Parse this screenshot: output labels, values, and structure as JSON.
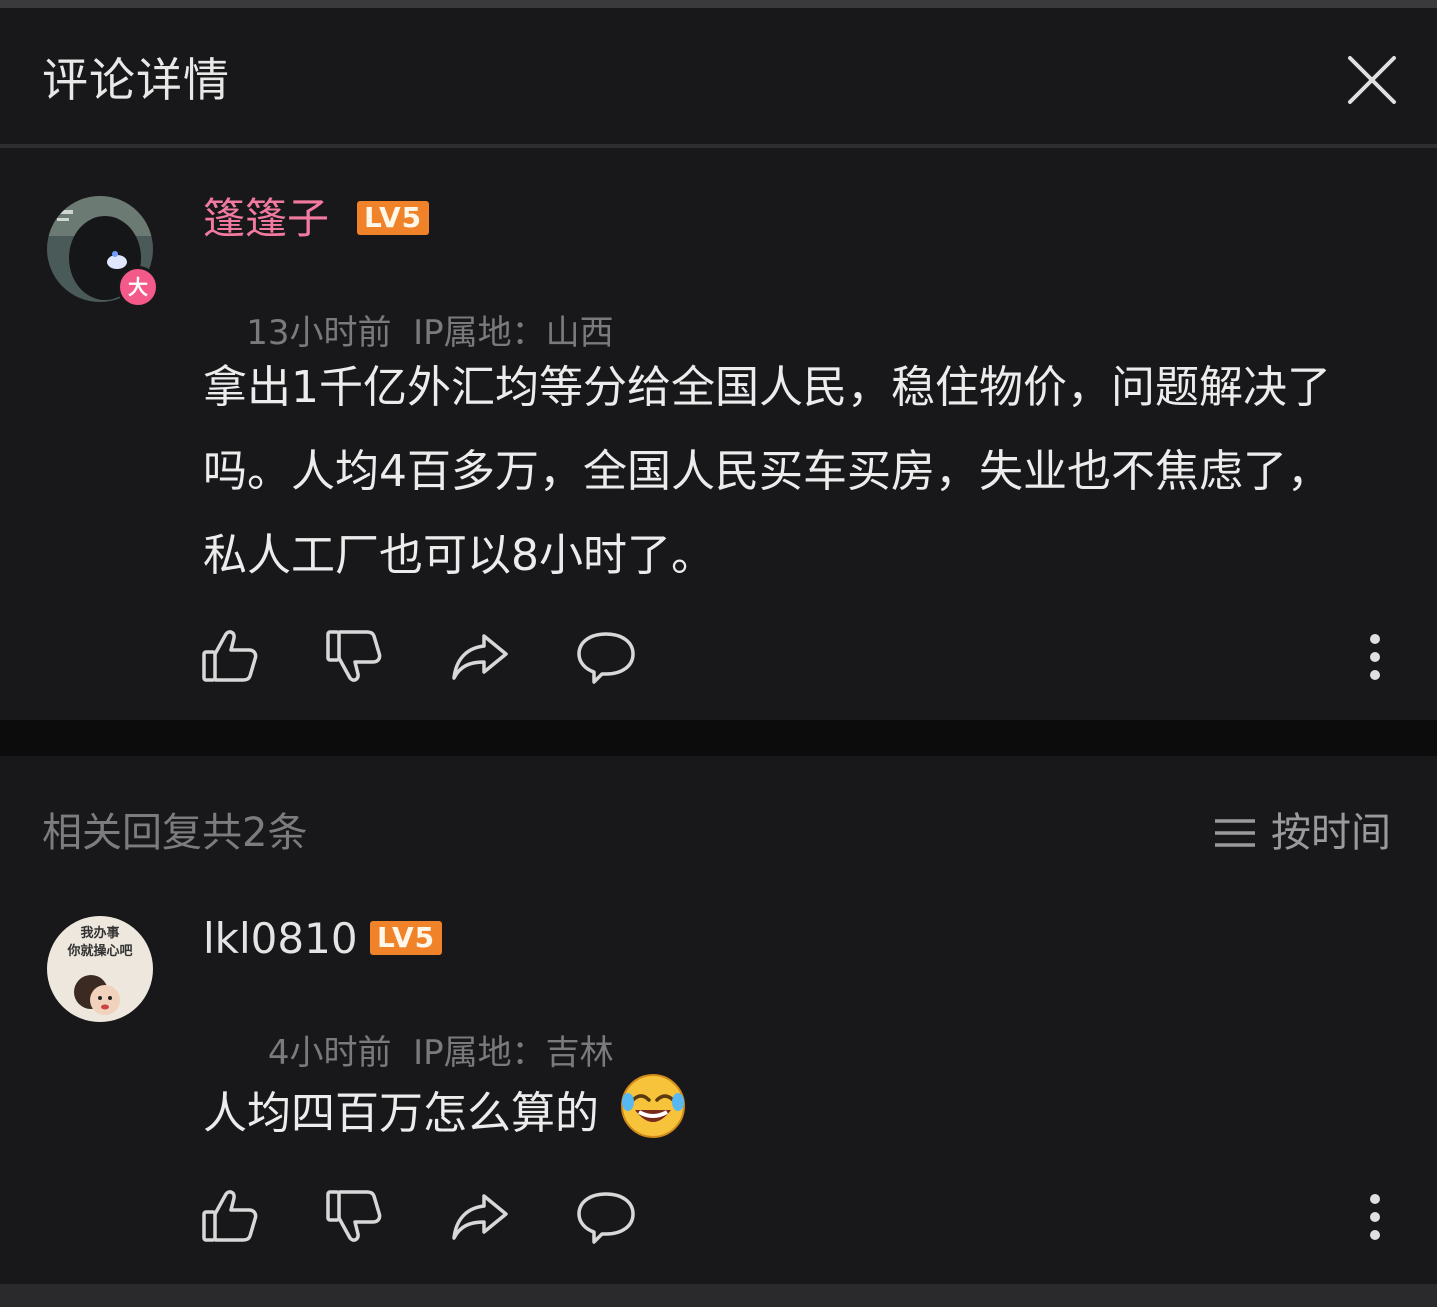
{
  "header": {
    "title": "评论详情"
  },
  "main_comment": {
    "username": "篷篷子",
    "level": "LV5",
    "avatar_badge": "大",
    "time": "13小时前",
    "ip": "IP属地：山西",
    "text": "拿出1千亿外汇均等分给全国人民，稳住物价，问题解决了吗。人均4百多万，全国人民买车买房，失业也不焦虑了，私人工厂也可以8小时了。"
  },
  "replies": {
    "title": "相关回复共2条",
    "sort_label": "按时间",
    "items": [
      {
        "username": "lkl0810",
        "level": "LV5",
        "avatar_text_line1": "我办事",
        "avatar_text_line2": "你就操心吧",
        "time": "4小时前",
        "ip": "IP属地：吉林",
        "text": "人均四百万怎么算的",
        "emoji": "laughing-tears-emoji"
      }
    ]
  },
  "icons": [
    "close-icon",
    "like-icon",
    "dislike-icon",
    "share-icon",
    "comment-icon",
    "more-icon",
    "sort-icon"
  ],
  "colors": {
    "background": "#18181a",
    "username_pink": "#f27aa0",
    "level_orange": "#f0832a",
    "meta_gray": "#7a7a7c"
  }
}
